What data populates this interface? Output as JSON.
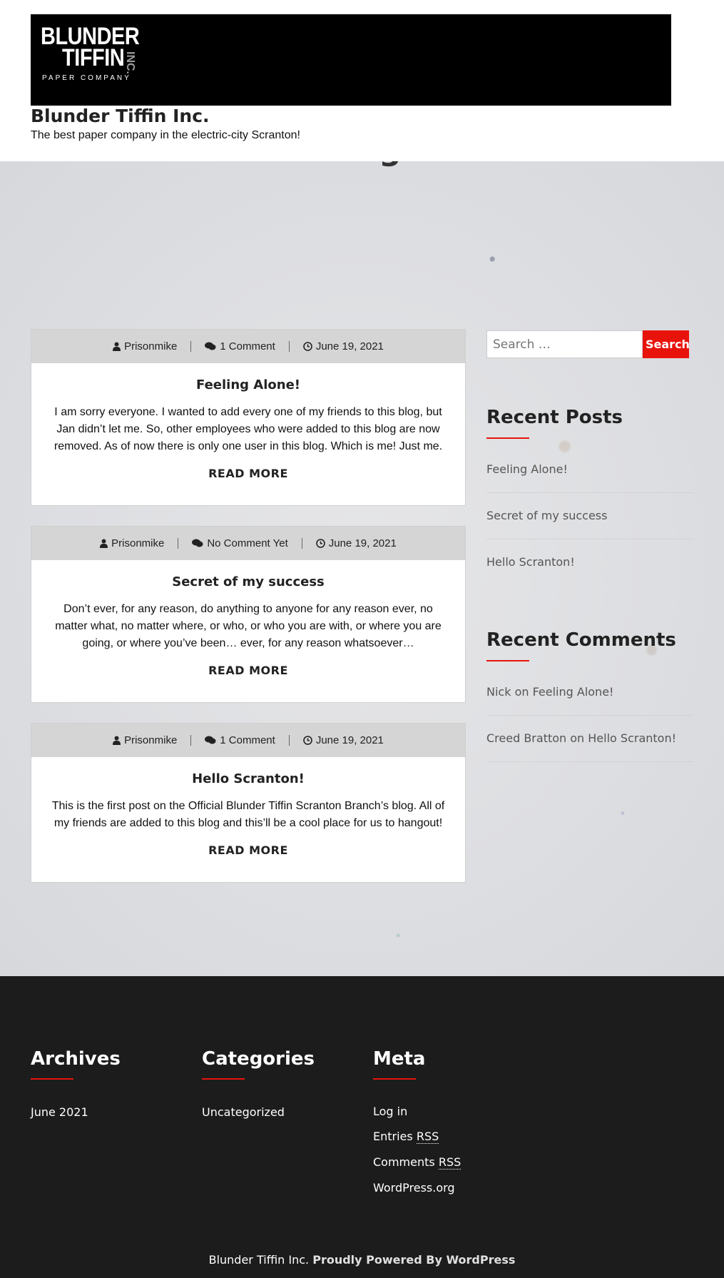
{
  "header": {
    "logo_line1": "BLUNDER",
    "logo_line2": "TIFFIN",
    "logo_inc": "INC.",
    "logo_tagline": "PAPER COMPANY",
    "site_title": "Blunder Tiffin Inc.",
    "site_description": "The best paper company in the electric-city Scranton!"
  },
  "page": {
    "heading": "Blog"
  },
  "posts": [
    {
      "author": "Prisonmike",
      "comments": "1 Comment",
      "date": "June 19, 2021",
      "title": "Feeling Alone!",
      "excerpt": "I am sorry everyone. I wanted to add every one of my friends to this blog, but Jan didn’t let me. So, other employees who were added to this blog are now removed. As of now there is only one user in this blog. Which is me! Just me.",
      "read_more": "READ MORE"
    },
    {
      "author": "Prisonmike",
      "comments": "No Comment Yet",
      "date": "June 19, 2021",
      "title": "Secret of my success",
      "excerpt": "Don’t ever, for any reason, do anything to anyone for any reason ever, no matter what, no matter where, or who, or who you are with, or where you are going, or where you’ve been… ever, for any reason whatsoever…",
      "read_more": "READ MORE"
    },
    {
      "author": "Prisonmike",
      "comments": "1 Comment",
      "date": "June 19, 2021",
      "title": "Hello Scranton!",
      "excerpt": "This is the first post on the Official Blunder Tiffin Scranton Branch’s blog. All of my friends are added to this blog and this’ll be a cool place for us to hangout!",
      "read_more": "READ MORE"
    }
  ],
  "sidebar": {
    "search_placeholder": "Search …",
    "search_button": "Search",
    "recent_posts_title": "Recent Posts",
    "recent_posts": [
      "Feeling Alone!",
      "Secret of my success",
      "Hello Scranton!"
    ],
    "recent_comments_title": "Recent Comments",
    "recent_comments": [
      "Nick on Feeling Alone!",
      "Creed Bratton on Hello Scranton!"
    ]
  },
  "footer": {
    "archives_title": "Archives",
    "archives": [
      "June 2021"
    ],
    "categories_title": "Categories",
    "categories": [
      "Uncategorized"
    ],
    "meta_title": "Meta",
    "meta": {
      "login": "Log in",
      "entries": "Entries",
      "comments": "Comments",
      "rss": "RSS",
      "wordpress": "WordPress.org"
    },
    "site_name": "Blunder Tiffin Inc.",
    "powered_by": "Proudly Powered By WordPress"
  },
  "colors": {
    "accent": "#e8140c",
    "footer_bg": "#1c1c1c",
    "meta_bar": "#d5d5d5"
  },
  "icons": {
    "author": "user-icon",
    "comments": "comments-icon",
    "date": "clock-icon"
  }
}
